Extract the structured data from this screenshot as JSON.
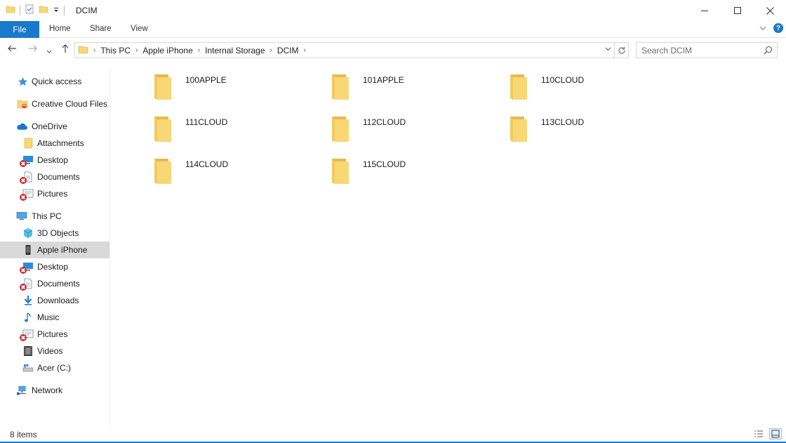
{
  "window": {
    "title": "DCIM",
    "controls": {
      "minimize": "minimize",
      "maximize": "maximize",
      "close": "close"
    }
  },
  "ribbon": {
    "tabs": [
      {
        "label": "File"
      },
      {
        "label": "Home"
      },
      {
        "label": "Share"
      },
      {
        "label": "View"
      }
    ],
    "help": "?"
  },
  "address": {
    "breadcrumbs": [
      {
        "label": "This PC"
      },
      {
        "label": "Apple iPhone"
      },
      {
        "label": "Internal Storage"
      },
      {
        "label": "DCIM"
      }
    ]
  },
  "search": {
    "placeholder": "Search DCIM"
  },
  "nav_pane": {
    "items": [
      {
        "label": "Quick access",
        "icon": "star-icon",
        "level": 0,
        "error": false
      },
      {
        "label": "Creative Cloud Files",
        "icon": "creative-cloud-folder-icon",
        "level": 0,
        "error": false
      },
      {
        "label": "OneDrive",
        "icon": "onedrive-cloud-icon",
        "level": 0,
        "error": false
      },
      {
        "label": "Attachments",
        "icon": "folder-icon",
        "level": 1,
        "error": false
      },
      {
        "label": "Desktop",
        "icon": "desktop-icon",
        "level": 1,
        "error": true
      },
      {
        "label": "Documents",
        "icon": "documents-icon",
        "level": 1,
        "error": true
      },
      {
        "label": "Pictures",
        "icon": "pictures-icon",
        "level": 1,
        "error": true
      },
      {
        "label": "This PC",
        "icon": "computer-icon",
        "level": 0,
        "error": false
      },
      {
        "label": "3D Objects",
        "icon": "cube-icon",
        "level": 1,
        "error": false
      },
      {
        "label": "Apple iPhone",
        "icon": "phone-icon",
        "level": 1,
        "error": false,
        "selected": true
      },
      {
        "label": "Desktop",
        "icon": "desktop-icon",
        "level": 1,
        "error": true
      },
      {
        "label": "Documents",
        "icon": "documents-icon",
        "level": 1,
        "error": true
      },
      {
        "label": "Downloads",
        "icon": "download-arrow-icon",
        "level": 1,
        "error": false
      },
      {
        "label": "Music",
        "icon": "music-note-icon",
        "level": 1,
        "error": false
      },
      {
        "label": "Pictures",
        "icon": "pictures-icon",
        "level": 1,
        "error": true
      },
      {
        "label": "Videos",
        "icon": "film-icon",
        "level": 1,
        "error": false
      },
      {
        "label": "Acer (C:)",
        "icon": "drive-icon",
        "level": 1,
        "error": false
      },
      {
        "label": "Network",
        "icon": "network-icon",
        "level": 0,
        "error": false
      }
    ]
  },
  "folders": [
    {
      "name": "100APPLE"
    },
    {
      "name": "101APPLE"
    },
    {
      "name": "110CLOUD"
    },
    {
      "name": "111CLOUD"
    },
    {
      "name": "112CLOUD"
    },
    {
      "name": "113CLOUD"
    },
    {
      "name": "114CLOUD"
    },
    {
      "name": "115CLOUD"
    }
  ],
  "status": {
    "item_count": "8 items",
    "view": "large-icons"
  },
  "colors": {
    "accent": "#1979ca",
    "folder": "#f8d775",
    "folder_dark": "#e8b84b",
    "selected": "#d9d9d9",
    "error": "#d0282c"
  }
}
